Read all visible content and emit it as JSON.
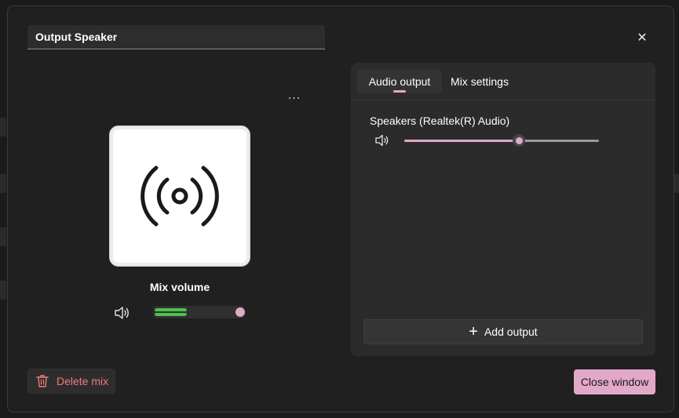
{
  "mix_name": {
    "value": "Output Speaker",
    "placeholder": ""
  },
  "close_icon_glyph": "✕",
  "more_icon_glyph": "···",
  "art_icon": "broadcast-icon",
  "mix_volume": {
    "label": "Mix volume",
    "level": 0.96,
    "meter": 0.35
  },
  "delete_button": {
    "label": "Delete mix",
    "icon": "trash-icon"
  },
  "tabs": [
    {
      "label": "Audio output",
      "active": true
    },
    {
      "label": "Mix settings",
      "active": false
    }
  ],
  "device": {
    "name": "Speakers (Realtek(R) Audio)",
    "level": 0.59
  },
  "add_output": {
    "label": "Add output",
    "icon_glyph": "+"
  },
  "close_window": {
    "label": "Close window"
  },
  "colors": {
    "accent": "#e2a8c8",
    "meter": "#4ec24e",
    "danger": "#f07b7b",
    "dialog_bg": "#202020",
    "panel_bg": "#2b2b2b"
  }
}
